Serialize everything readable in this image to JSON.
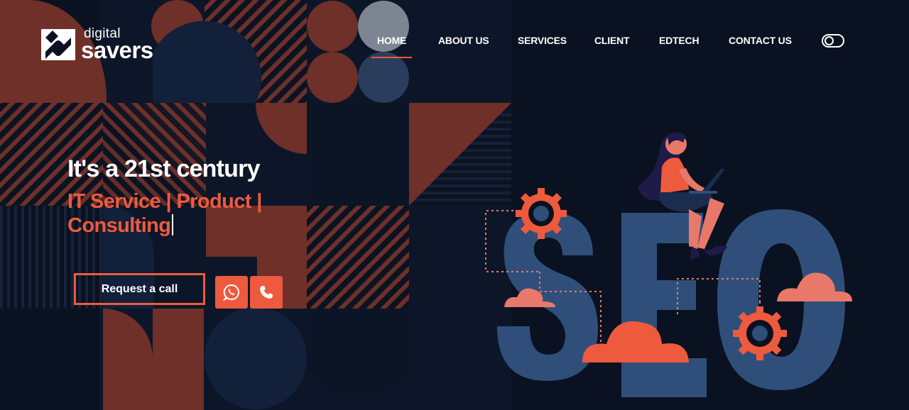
{
  "brand": {
    "name_small": "digital",
    "name_big": "savers"
  },
  "nav": {
    "items": [
      {
        "label": "HOME",
        "active": true
      },
      {
        "label": "ABOUT US",
        "active": false
      },
      {
        "label": "SERVICES",
        "active": false
      },
      {
        "label": "CLIENT",
        "active": false
      },
      {
        "label": "EDTECH",
        "active": false
      },
      {
        "label": "CONTACT US",
        "active": false
      }
    ],
    "theme_toggle_icon": "toggle-icon"
  },
  "hero": {
    "headline": "It's a 21st century",
    "subline_1": "IT Service | Product |",
    "subline_2": "Consulting",
    "cta_label": "Request a call",
    "whatsapp_icon": "whatsapp-icon",
    "phone_icon": "phone-icon"
  },
  "illustration": {
    "letters": "SEO"
  },
  "colors": {
    "background": "#0a1120",
    "accent": "#ee5a3e",
    "rust": "#6e3028",
    "navy": "#12203a",
    "seo_blue": "#2f4f7a",
    "text": "#ffffff"
  }
}
